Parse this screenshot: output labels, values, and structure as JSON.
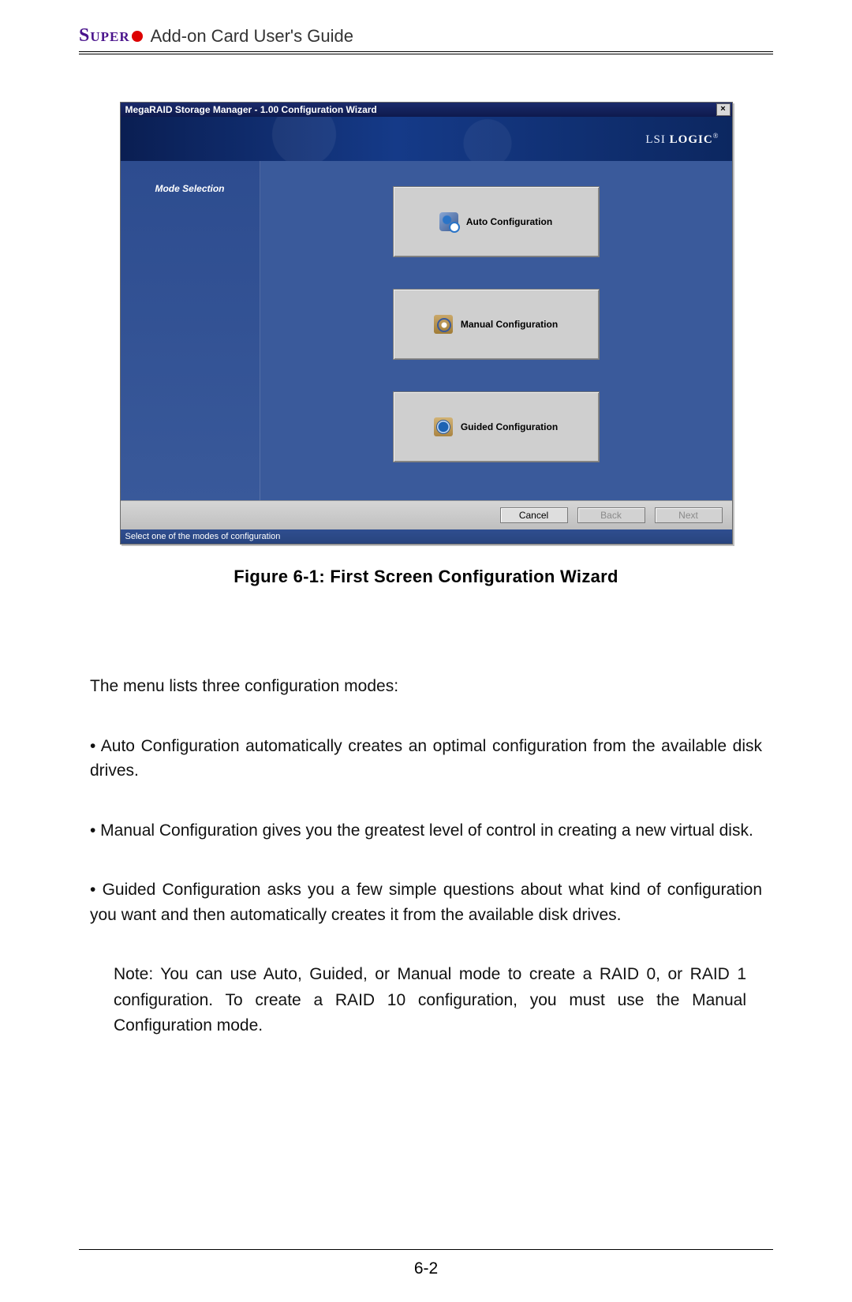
{
  "doc": {
    "logo_text": "Super",
    "header_title": "Add-on Card User's Guide",
    "caption": "Figure 6-1: First Screen Configuration Wizard",
    "intro": "The menu lists three configuration modes:",
    "bullets": [
      "• Auto Configuration automatically creates an optimal configuration from the available disk drives.",
      "• Manual Configuration gives you the greatest level of control in creating a new virtual disk.",
      "• Guided Configuration asks you a few simple questions about what kind of configuration you want and then automatically creates it from the available disk drives."
    ],
    "note": "Note: You can use Auto, Guided, or Manual mode to create a RAID 0, or RAID 1 configuration. To create a RAID 10 configuration, you must use the Manual Configuration mode.",
    "page_number": "6-2"
  },
  "window": {
    "title": "MegaRAID Storage Manager - 1.00 Configuration Wizard",
    "brand_html": "LSI LOGIC",
    "side_label": "Mode Selection",
    "options": {
      "auto": "Auto Configuration",
      "manual": "Manual Configuration",
      "guided": "Guided Configuration"
    },
    "buttons": {
      "cancel": "Cancel",
      "back": "Back",
      "next": "Next"
    },
    "status": "Select one of the modes of configuration"
  }
}
